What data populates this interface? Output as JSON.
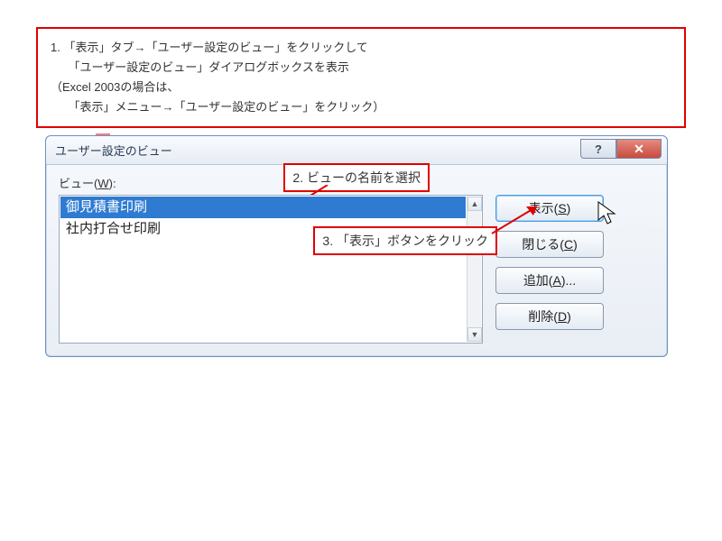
{
  "step1": {
    "line1": "1. 「表示」タブ→「ユーザー設定のビュー」をクリックして",
    "line2": "　　「ユーザー設定のビュー」ダイアログボックスを表示",
    "line3": "（Excel 2003の場合は、",
    "line4": "　　「表示」メニュー→「ユーザー設定のビュー」をクリック）"
  },
  "dialog": {
    "title": "ユーザー設定のビュー",
    "help_glyph": "?",
    "close_glyph": "✕",
    "view_label_prefix": "ビュー(",
    "view_label_key": "W",
    "view_label_suffix": "):",
    "items": [
      "御見積書印刷",
      "社内打合せ印刷"
    ],
    "selected_index": 0,
    "buttons": {
      "show": {
        "text": "表示(",
        "key": "S",
        "suffix": ")"
      },
      "close": {
        "text": "閉じる(",
        "key": "C",
        "suffix": ")"
      },
      "add": {
        "text": "追加(",
        "key": "A",
        "suffix": ")..."
      },
      "delete": {
        "text": "削除(",
        "key": "D",
        "suffix": ")"
      }
    },
    "scroll_up": "▲",
    "scroll_down": "▼"
  },
  "callout2": "2. ビューの名前を選択",
  "callout3": "3. 「表示」ボタンをクリック"
}
